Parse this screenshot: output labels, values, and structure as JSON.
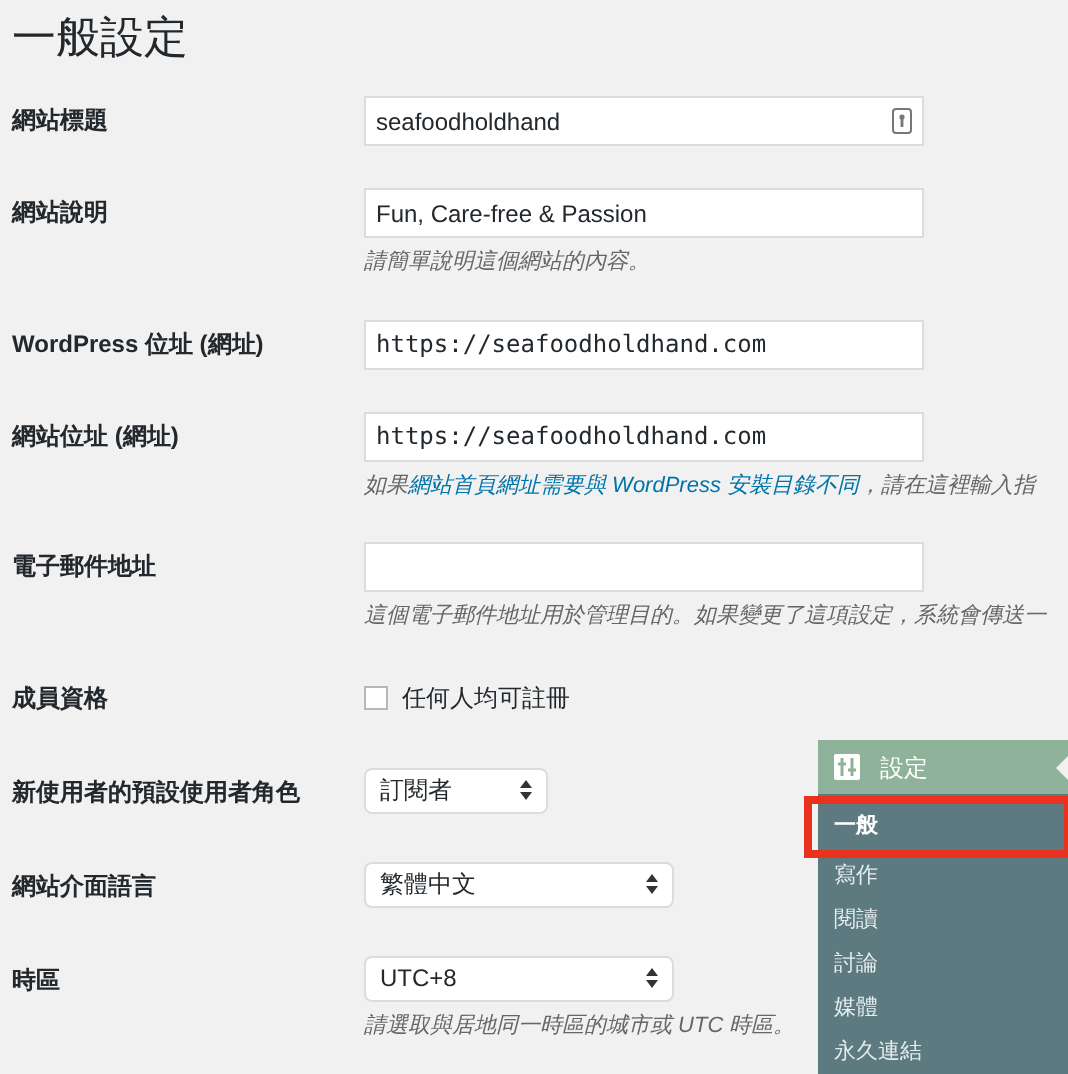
{
  "page_title": "一般設定",
  "rows": [
    {
      "kind": "text",
      "label": "網站標題",
      "value": "seafoodholdhand",
      "mono": false,
      "field_icon": true
    },
    {
      "kind": "text",
      "label": "網站說明",
      "value": "Fun, Care-free & Passion",
      "mono": false,
      "hint": {
        "before": "請簡單說明這個網站的內容。"
      }
    },
    {
      "kind": "text",
      "label": "WordPress 位址 (網址)",
      "value": "https://seafoodholdhand.com",
      "mono": true
    },
    {
      "kind": "text",
      "label": "網站位址 (網址)",
      "value": "https://seafoodholdhand.com",
      "mono": true,
      "hint": {
        "before": "如果",
        "link": "網站首頁網址需要與 WordPress 安裝目錄不同",
        "after": "，請在這裡輸入指"
      }
    },
    {
      "kind": "text",
      "label": "電子郵件地址",
      "value": "",
      "hint": {
        "before": "這個電子郵件地址用於管理目的。如果變更了這項設定，系統會傳送一"
      }
    },
    {
      "kind": "checkbox",
      "label": "成員資格",
      "option": "任何人均可註冊",
      "checked": false
    },
    {
      "kind": "select",
      "label": "新使用者的預設使用者角色",
      "value": "訂閱者",
      "narrow": true
    },
    {
      "kind": "select",
      "label": "網站介面語言",
      "value": "繁體中文",
      "narrow": false
    },
    {
      "kind": "select",
      "label": "時區",
      "value": "UTC+8",
      "narrow": false,
      "hint": {
        "before": "請選取與居地同一時區的城市或 UTC 時區。"
      }
    }
  ],
  "menu": {
    "title": "設定",
    "items": [
      {
        "label": "一般",
        "selected": true,
        "outlined": true
      },
      {
        "label": "寫作",
        "selected": false,
        "outlined": false
      },
      {
        "label": "閱讀",
        "selected": false,
        "outlined": false
      },
      {
        "label": "討論",
        "selected": false,
        "outlined": false
      },
      {
        "label": "媒體",
        "selected": false,
        "outlined": false
      },
      {
        "label": "永久連結",
        "selected": false,
        "outlined": false
      }
    ]
  }
}
